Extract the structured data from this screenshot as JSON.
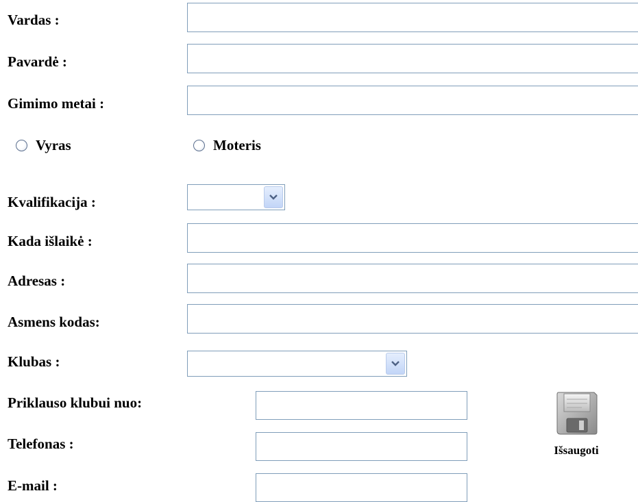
{
  "form": {
    "vardas": {
      "label": "Vardas :",
      "value": ""
    },
    "pavarde": {
      "label": "Pavardė :",
      "value": ""
    },
    "gimimo_metai": {
      "label": "Gimimo metai :",
      "value": ""
    },
    "gender": {
      "options": [
        {
          "label": "Vyras",
          "checked": false
        },
        {
          "label": "Moteris",
          "checked": false
        }
      ]
    },
    "kvalifikacija": {
      "label": "Kvalifikacija :",
      "selected": ""
    },
    "kada_islaike": {
      "label": "Kada išlaikė :",
      "value": ""
    },
    "adresas": {
      "label": "Adresas :",
      "value": ""
    },
    "asmens_kodas": {
      "label": "Asmens kodas:",
      "value": ""
    },
    "klubas": {
      "label": "Klubas :",
      "selected": ""
    },
    "priklauso_klubui_nuo": {
      "label": "Priklauso klubui nuo:",
      "value": ""
    },
    "telefonas": {
      "label": "Telefonas :",
      "value": ""
    },
    "email": {
      "label": "E-mail :",
      "value": ""
    }
  },
  "save_button": {
    "label": "Išsaugoti",
    "icon": "floppy-disk-icon"
  },
  "colors": {
    "input_border": "#7f9db9",
    "dropdown_arrow": "#4d6185"
  }
}
